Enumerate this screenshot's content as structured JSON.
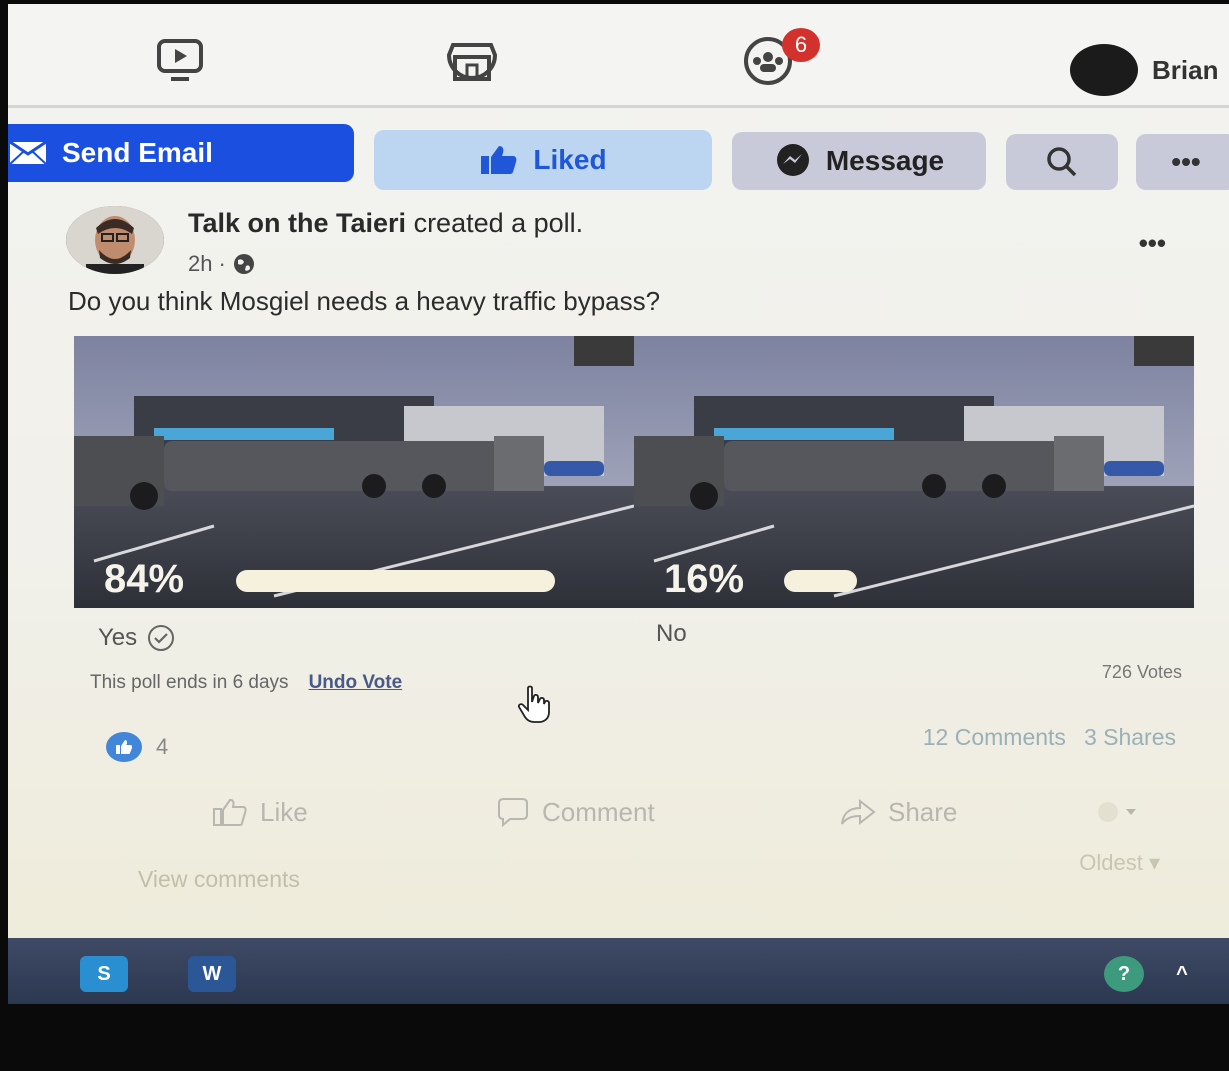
{
  "nav": {
    "groups_badge": "6",
    "profile_name": "Brian"
  },
  "page_actions": {
    "send_email": "Send Email",
    "liked": "Liked",
    "message": "Message",
    "more": "•••"
  },
  "post": {
    "author": "Talk on the Taieri",
    "action": "created a poll.",
    "time": "2h",
    "more": "•••",
    "question": "Do you think Mosgiel needs a heavy traffic bypass?",
    "poll": {
      "options": [
        {
          "label": "Yes",
          "percent_text": "84%",
          "percent": 84,
          "voted": true
        },
        {
          "label": "No",
          "percent_text": "16%",
          "percent": 16,
          "voted": false
        }
      ],
      "ends_text": "This poll ends in 6 days",
      "undo_vote": "Undo Vote",
      "votes_text": "726 Votes"
    },
    "reactions_count": "4",
    "comments_count": "12 Comments",
    "shares_count": "3 Shares",
    "actions": {
      "like": "Like",
      "comment": "Comment",
      "share": "Share"
    },
    "view_comments": "View comments",
    "sort_label": "Oldest"
  },
  "colors": {
    "facebook_blue": "#1a4fe0",
    "liked_bg": "#bcd5f0",
    "badge_red": "#d2322b"
  }
}
